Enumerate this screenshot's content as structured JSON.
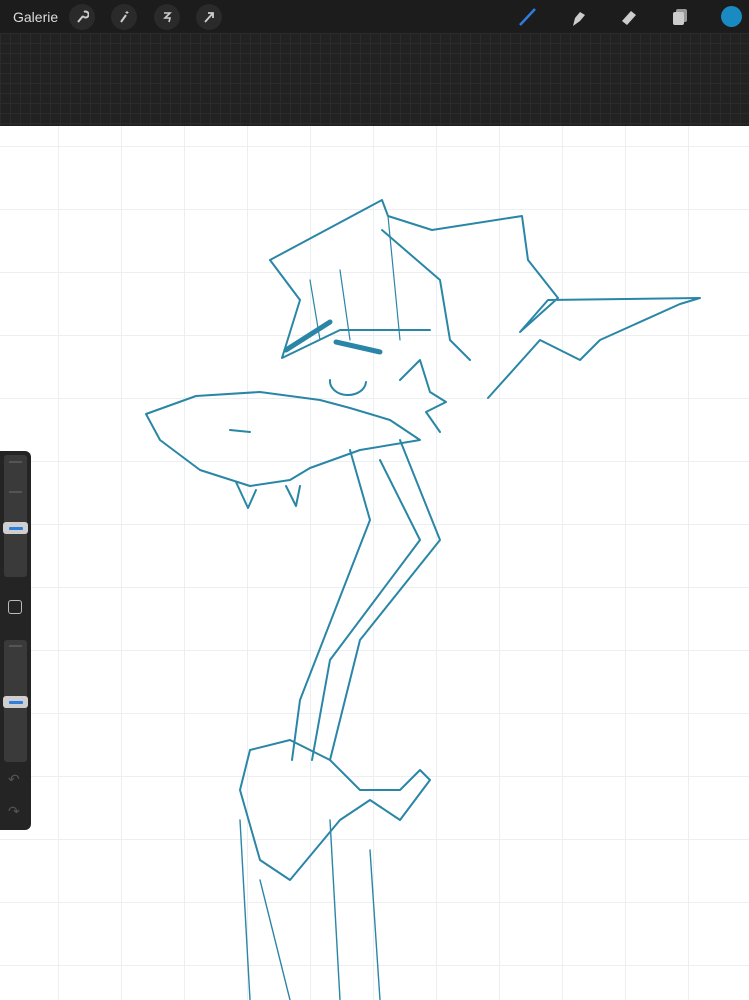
{
  "topbar": {
    "gallery_label": "Galerie",
    "tools_left": [
      "wrench-icon",
      "magic-wand-icon",
      "selection-icon",
      "transform-arrow-icon"
    ],
    "tools_right": [
      "brush-icon",
      "smudge-icon",
      "eraser-icon",
      "layers-icon"
    ],
    "active_tool": "brush",
    "current_color": "#1a8ac2"
  },
  "sidebar": {
    "brush_size": 0.4,
    "opacity": 0.5
  },
  "colors": {
    "stroke": "#2a86a6",
    "accent": "#2f7de1"
  }
}
